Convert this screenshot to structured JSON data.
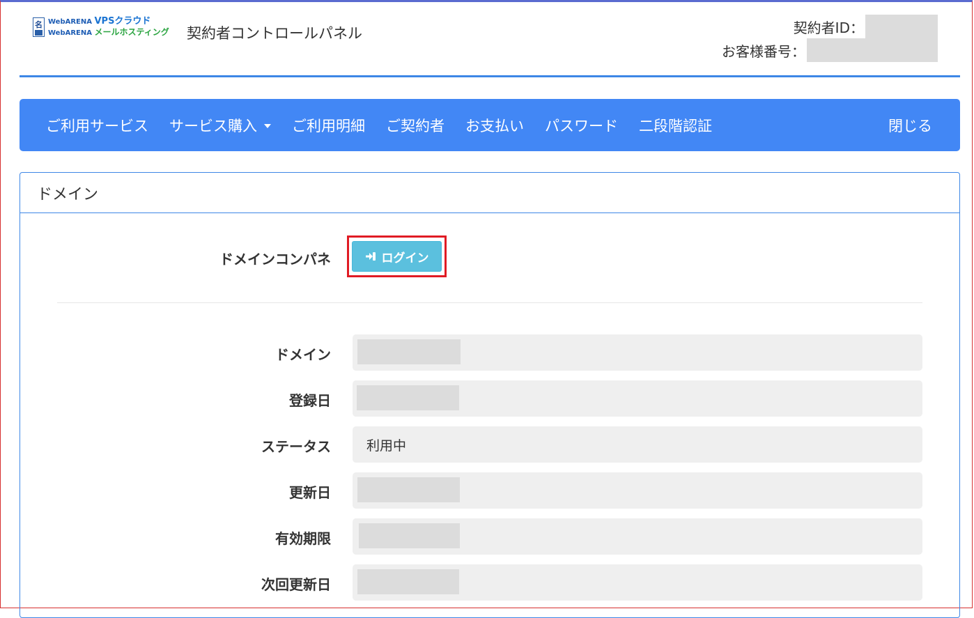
{
  "logo": {
    "mark": "名",
    "line1_small": "WebARENA",
    "line1_big": "VPSクラウド",
    "line2_small": "WebARENA",
    "line2_big": "メールホスティング"
  },
  "header": {
    "title": "契約者コントロールパネル",
    "contract_id_label": "契約者ID：",
    "customer_number_label": "お客様番号："
  },
  "nav": {
    "items": [
      "ご利用サービス",
      "サービス購入",
      "ご利用明細",
      "ご契約者",
      "お支払い",
      "パスワード",
      "二段階認証"
    ],
    "close": "閉じる"
  },
  "panel": {
    "title": "ドメイン",
    "control_panel_label": "ドメインコンパネ",
    "login_button": "ログイン",
    "fields": {
      "domain": {
        "label": "ドメイン",
        "value": ""
      },
      "registered": {
        "label": "登録日",
        "value": ""
      },
      "status": {
        "label": "ステータス",
        "value": "利用中"
      },
      "updated": {
        "label": "更新日",
        "value": ""
      },
      "expiry": {
        "label": "有効期限",
        "value": ""
      },
      "next_renewal": {
        "label": "次回更新日",
        "value": ""
      }
    }
  },
  "colors": {
    "nav_bg": "#4287f5",
    "accent": "#3d87e6",
    "login_btn": "#5bc0de",
    "highlight": "#e01b24"
  }
}
